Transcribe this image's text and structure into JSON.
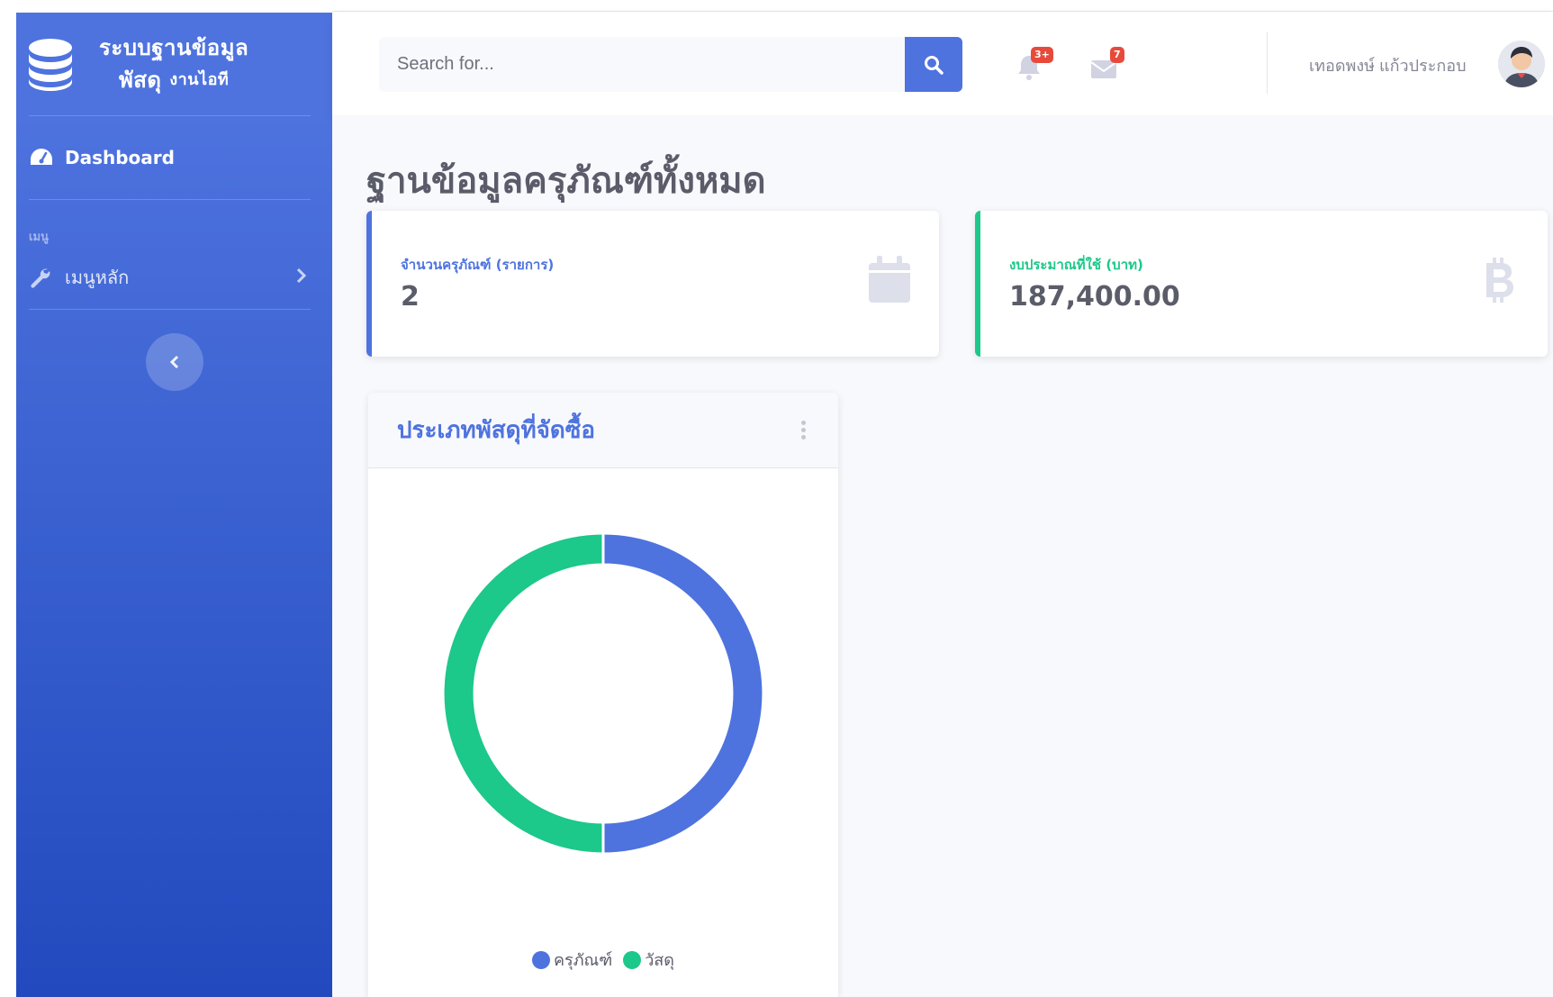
{
  "brand": {
    "line1": "ระบบฐานข้อมูล",
    "line2": "พัสดุ",
    "line2_sup": "งานไอที"
  },
  "sidebar": {
    "dashboard_label": "Dashboard",
    "heading": "เมนู",
    "menu_label": "เมนูหลัก"
  },
  "search": {
    "placeholder": "Search for..."
  },
  "topbar": {
    "alerts_badge": "3+",
    "messages_badge": "7",
    "username": "เทอดพงษ์ แก้วประกอบ"
  },
  "page": {
    "title": "ฐานข้อมูลครุภัณฑ์ทั้งหมด"
  },
  "stats": [
    {
      "label": "จำนวนครุภัณฑ์ (รายการ)",
      "value": "2",
      "color": "#4e73df",
      "icon": "calendar-icon"
    },
    {
      "label": "งบประมาณที่ใช้ (บาท)",
      "value": "187,400.00",
      "color": "#1cc88a",
      "icon": "bitcoin-icon"
    }
  ],
  "chart_card": {
    "title": "ประเภทพัสดุที่จัดซื้อ"
  },
  "chart_data": {
    "type": "pie",
    "categories": [
      "ครุภัณฑ์",
      "วัสดุ"
    ],
    "values": [
      50,
      50
    ],
    "colors": [
      "#4e73df",
      "#1cc88a"
    ],
    "legend": "bottom"
  }
}
